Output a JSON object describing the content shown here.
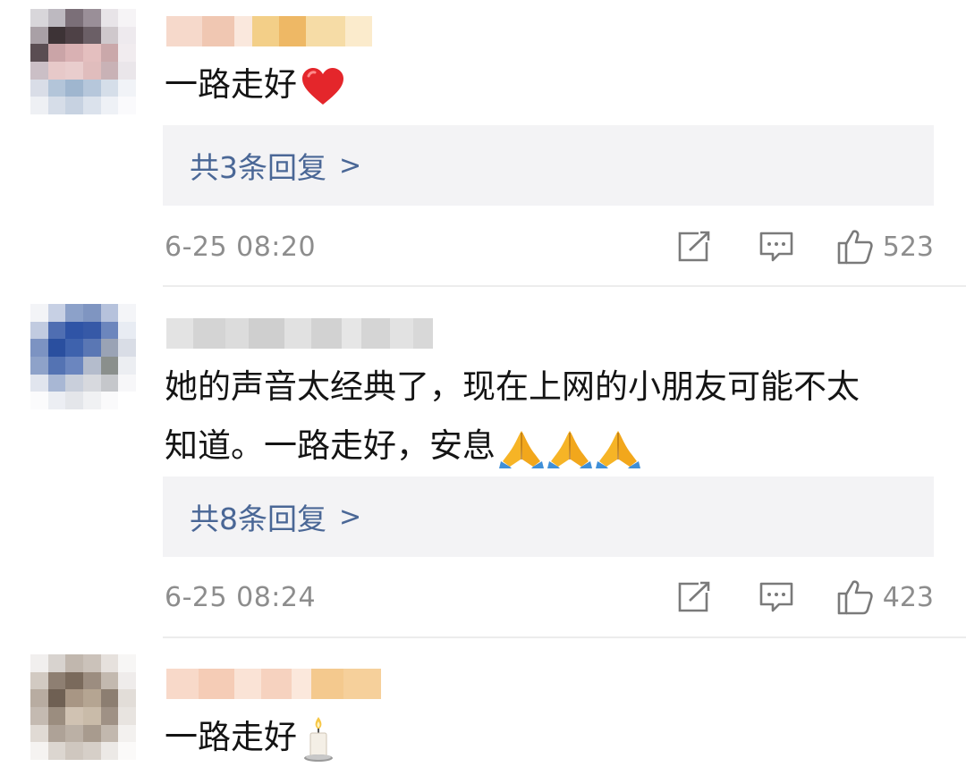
{
  "comments": [
    {
      "text": "一路走好",
      "emoji": "red-heart",
      "replies_label": "共3条回复",
      "time": "6-25 08:20",
      "likes": "523"
    },
    {
      "text_line1": "她的声音太经典了，现在上网的小朋友可能不太",
      "text_line2": "知道。一路走好，安息",
      "emoji": "folded-hands x3",
      "replies_label": "共8条回复",
      "time": "6-25 08:24",
      "likes": "423"
    },
    {
      "text": "一路走好",
      "emoji": "candle"
    }
  ],
  "reply_arrow": ">",
  "colors": {
    "reply_link": "#4a6796",
    "reply_bg": "#f3f3f5",
    "meta_gray": "#8d8d8d"
  },
  "icons": [
    "share-icon",
    "comment-icon",
    "like-icon"
  ]
}
